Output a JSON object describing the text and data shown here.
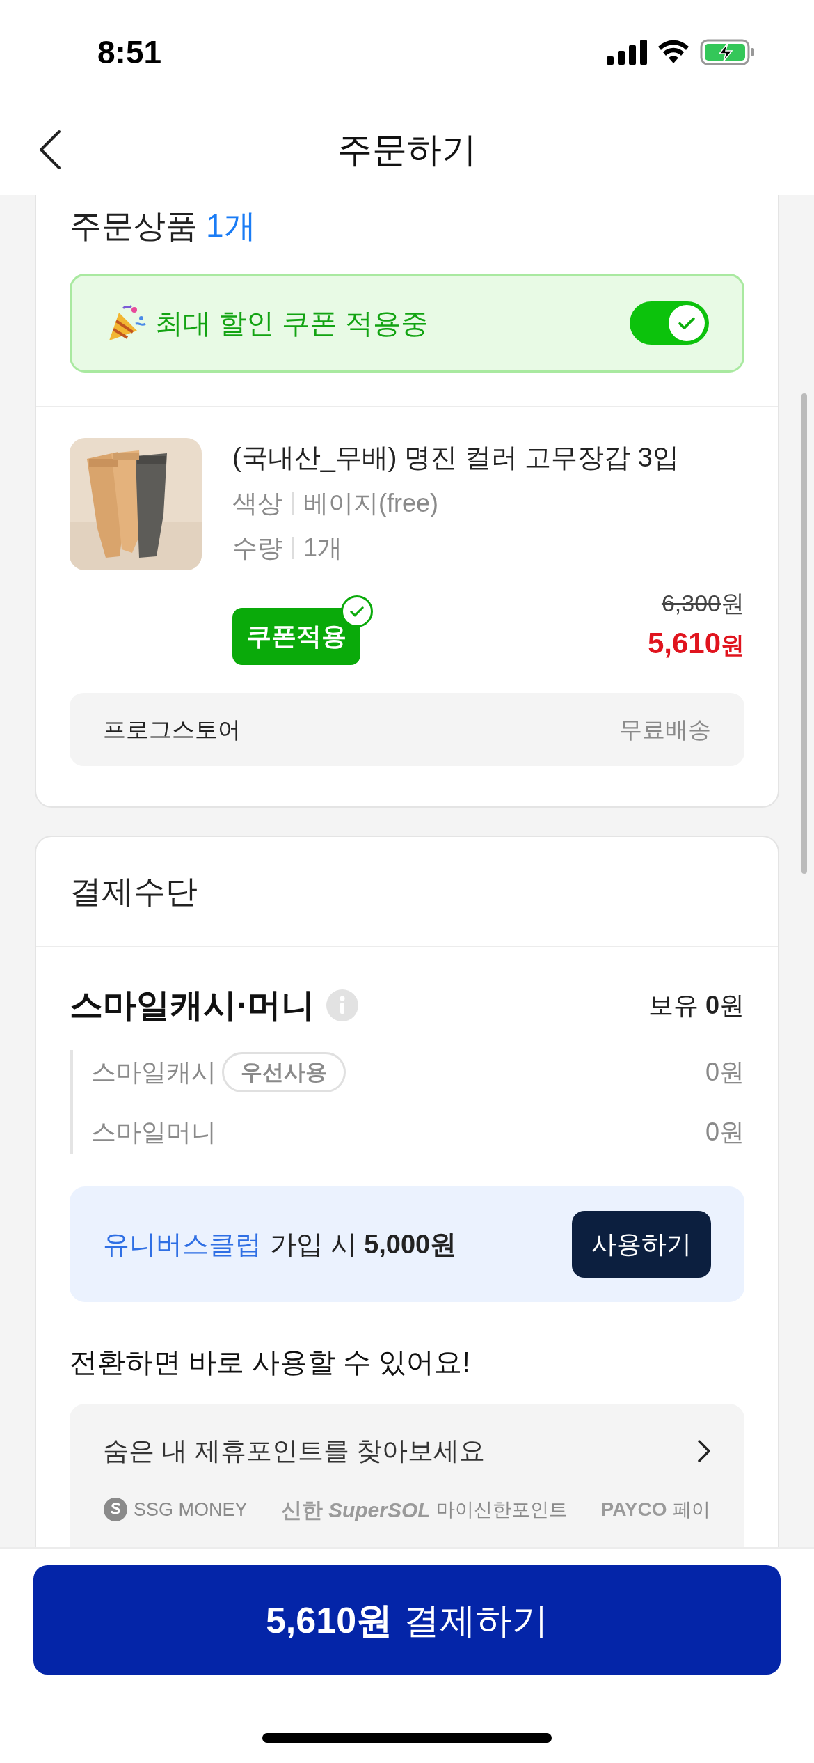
{
  "status_bar": {
    "time": "8:51",
    "charging": true
  },
  "nav": {
    "title": "주문하기"
  },
  "order": {
    "title": "주문상품",
    "count": "1개",
    "coupon_banner": {
      "text": "최대 할인 쿠폰 적용중",
      "on": true
    },
    "item": {
      "name": "(국내산_무배) 명진 컬러 고무장갑 3입",
      "options": [
        {
          "label": "색상",
          "value": "베이지(free)"
        },
        {
          "label": "수량",
          "value": "1개"
        }
      ],
      "coupon_button": {
        "label": "쿠폰적용",
        "applied": true
      },
      "original_price": "6,300",
      "original_unit": "원",
      "price": "5,610",
      "price_unit": "원"
    },
    "seller": {
      "name": "프로그스토어",
      "shipping": "무료배송"
    }
  },
  "payment": {
    "title": "결제수단",
    "smile": {
      "title": "스마일캐시·머니",
      "balance_label": "보유",
      "balance": "0",
      "balance_unit": "원",
      "rows": [
        {
          "label": "스마일캐시",
          "badge": "우선사용",
          "amount": "0원"
        },
        {
          "label": "스마일머니",
          "amount": "0원"
        }
      ]
    },
    "promo": {
      "link": "유니버스클럽",
      "text": "가입 시 **5,000원**",
      "button": "사용하기"
    },
    "convert_title": "전환하면 바로 사용할 수 있어요!",
    "points": {
      "title": "숨은 내 제휴포인트를 찾아보세요",
      "partners": [
        {
          "kind": "ssg",
          "text": "SSG MONEY"
        },
        {
          "kind": "shinhan",
          "logo_a": "신한",
          "logo_b": "SuperSOL",
          "text": "마이신한포인트"
        },
        {
          "kind": "payco",
          "logo_b": "PAYCO",
          "text": "페이"
        }
      ]
    }
  },
  "pay_button": {
    "amount": "5,610원",
    "label": "결제하기"
  }
}
